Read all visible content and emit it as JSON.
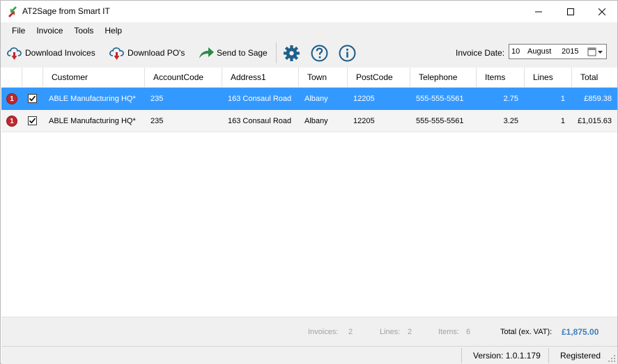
{
  "window": {
    "title": "AT2Sage from Smart IT",
    "minimize_glyph": "—",
    "maximize_glyph": "☐",
    "close_glyph": "✕"
  },
  "menu": {
    "file": "File",
    "invoice": "Invoice",
    "tools": "Tools",
    "help": "Help"
  },
  "toolbar": {
    "download_invoices": "Download Invoices",
    "download_pos": "Download PO's",
    "send_to_sage": "Send to Sage",
    "icons": [
      "cloud-download-icon",
      "cloud-download-icon",
      "send-arrow-icon",
      "gear-icon",
      "help-icon",
      "info-icon"
    ],
    "invoice_date_label": "Invoice Date:",
    "date_day": "10",
    "date_month": "August",
    "date_year": "2015"
  },
  "grid": {
    "columns": {
      "customer": "Customer",
      "account_code": "AccountCode",
      "address1": "Address1",
      "town": "Town",
      "postcode": "PostCode",
      "telephone": "Telephone",
      "items": "Items",
      "lines": "Lines",
      "total": "Total"
    },
    "rows": [
      {
        "error_glyph": "1",
        "checked": true,
        "customer": "ABLE Manufacturing HQ*",
        "account_code": "235",
        "address1": "163 Consaul Road",
        "town": "Albany",
        "postcode": "12205",
        "telephone": "555-555-5561",
        "items": "2.75",
        "lines": "1",
        "total": "£859.38"
      },
      {
        "error_glyph": "1",
        "checked": true,
        "customer": "ABLE Manufacturing HQ*",
        "account_code": "235",
        "address1": "163 Consaul Road",
        "town": "Albany",
        "postcode": "12205",
        "telephone": "555-555-5561",
        "items": "3.25",
        "lines": "1",
        "total": "£1,015.63"
      }
    ]
  },
  "summary": {
    "invoices_label": "Invoices:",
    "invoices_value": "2",
    "lines_label": "Lines:",
    "lines_value": "2",
    "items_label": "Items:",
    "items_value": "6",
    "total_label": "Total (ex. VAT):",
    "total_value": "£1,875.00"
  },
  "status": {
    "version": "Version:  1.0.1.179",
    "registered": "Registered"
  },
  "colors": {
    "selection": "#3399ff",
    "error_badge": "#c0282e",
    "total_accent": "#3d7fbe",
    "toolbar_icon": "#1f5f8b"
  }
}
